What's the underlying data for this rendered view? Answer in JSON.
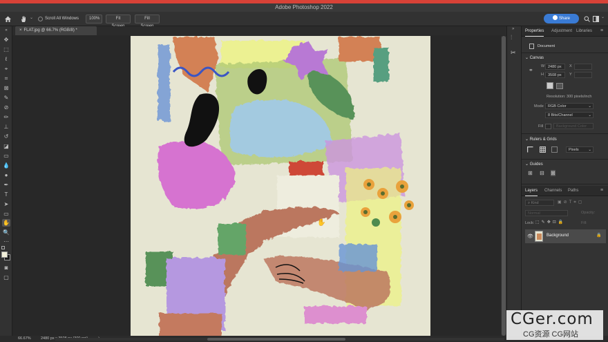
{
  "app": {
    "title": "Adobe Photoshop 2022",
    "accent": "#3a7bd5",
    "top_bar_color": "#d84237"
  },
  "options_bar": {
    "scroll_all_windows": "Scroll All Windows",
    "zoom_100": "100%",
    "fit_screen": "Fit Screen",
    "fill_screen": "Fill Screen",
    "share": "Share"
  },
  "document": {
    "tab_label": "FLAT.jpg @ 66.7% (RGB/8) *"
  },
  "right_panel": {
    "tabs": [
      "Properties",
      "Adjustment",
      "Libraries"
    ],
    "document_label": "Document",
    "canvas": {
      "title": "Canvas",
      "w_label": "W",
      "w_value": "2480 px",
      "h_label": "H",
      "h_value": "3508 px",
      "x_label": "X",
      "y_label": "Y",
      "resolution": "Resolution: 300 pixels/inch",
      "mode_label": "Mode",
      "mode_value": "RGB Color",
      "bits_value": "8 Bits/Channel",
      "fill_label": "Fill",
      "fill_value": "Background Color"
    },
    "rulers": {
      "title": "Rulers & Grids",
      "unit": "Pixels"
    },
    "guides": {
      "title": "Guides"
    }
  },
  "layers_panel": {
    "tabs": [
      "Layers",
      "Channels",
      "Paths"
    ],
    "kind_label": "Kind",
    "blend_mode": "Normal",
    "opacity_label": "Opacity:",
    "lock_label": "Lock:",
    "fill_label": "Fill:",
    "layers": [
      {
        "name": "Background",
        "visible": true,
        "locked": true
      }
    ]
  },
  "status": {
    "zoom": "66.67%",
    "doc_info": "2480 px x 3508 px (300 ppi)"
  },
  "watermark": {
    "line1": "CGer.com",
    "line2": "CG资源 CG网站"
  }
}
